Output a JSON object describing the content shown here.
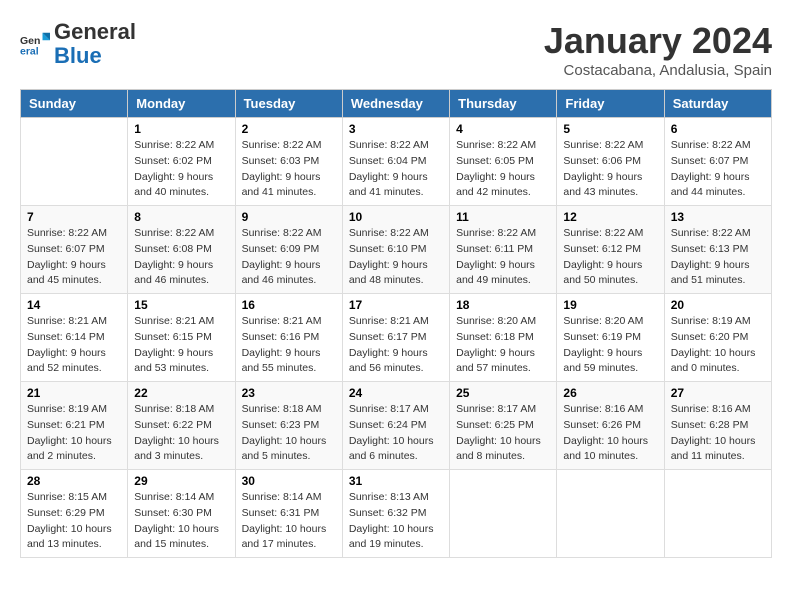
{
  "logo": {
    "general": "General",
    "blue": "Blue"
  },
  "header": {
    "month": "January 2024",
    "location": "Costacabana, Andalusia, Spain"
  },
  "weekdays": [
    "Sunday",
    "Monday",
    "Tuesday",
    "Wednesday",
    "Thursday",
    "Friday",
    "Saturday"
  ],
  "weeks": [
    [
      {
        "num": "",
        "sunrise": "",
        "sunset": "",
        "daylight": ""
      },
      {
        "num": "1",
        "sunrise": "Sunrise: 8:22 AM",
        "sunset": "Sunset: 6:02 PM",
        "daylight": "Daylight: 9 hours and 40 minutes."
      },
      {
        "num": "2",
        "sunrise": "Sunrise: 8:22 AM",
        "sunset": "Sunset: 6:03 PM",
        "daylight": "Daylight: 9 hours and 41 minutes."
      },
      {
        "num": "3",
        "sunrise": "Sunrise: 8:22 AM",
        "sunset": "Sunset: 6:04 PM",
        "daylight": "Daylight: 9 hours and 41 minutes."
      },
      {
        "num": "4",
        "sunrise": "Sunrise: 8:22 AM",
        "sunset": "Sunset: 6:05 PM",
        "daylight": "Daylight: 9 hours and 42 minutes."
      },
      {
        "num": "5",
        "sunrise": "Sunrise: 8:22 AM",
        "sunset": "Sunset: 6:06 PM",
        "daylight": "Daylight: 9 hours and 43 minutes."
      },
      {
        "num": "6",
        "sunrise": "Sunrise: 8:22 AM",
        "sunset": "Sunset: 6:07 PM",
        "daylight": "Daylight: 9 hours and 44 minutes."
      }
    ],
    [
      {
        "num": "7",
        "sunrise": "Sunrise: 8:22 AM",
        "sunset": "Sunset: 6:07 PM",
        "daylight": "Daylight: 9 hours and 45 minutes."
      },
      {
        "num": "8",
        "sunrise": "Sunrise: 8:22 AM",
        "sunset": "Sunset: 6:08 PM",
        "daylight": "Daylight: 9 hours and 46 minutes."
      },
      {
        "num": "9",
        "sunrise": "Sunrise: 8:22 AM",
        "sunset": "Sunset: 6:09 PM",
        "daylight": "Daylight: 9 hours and 46 minutes."
      },
      {
        "num": "10",
        "sunrise": "Sunrise: 8:22 AM",
        "sunset": "Sunset: 6:10 PM",
        "daylight": "Daylight: 9 hours and 48 minutes."
      },
      {
        "num": "11",
        "sunrise": "Sunrise: 8:22 AM",
        "sunset": "Sunset: 6:11 PM",
        "daylight": "Daylight: 9 hours and 49 minutes."
      },
      {
        "num": "12",
        "sunrise": "Sunrise: 8:22 AM",
        "sunset": "Sunset: 6:12 PM",
        "daylight": "Daylight: 9 hours and 50 minutes."
      },
      {
        "num": "13",
        "sunrise": "Sunrise: 8:22 AM",
        "sunset": "Sunset: 6:13 PM",
        "daylight": "Daylight: 9 hours and 51 minutes."
      }
    ],
    [
      {
        "num": "14",
        "sunrise": "Sunrise: 8:21 AM",
        "sunset": "Sunset: 6:14 PM",
        "daylight": "Daylight: 9 hours and 52 minutes."
      },
      {
        "num": "15",
        "sunrise": "Sunrise: 8:21 AM",
        "sunset": "Sunset: 6:15 PM",
        "daylight": "Daylight: 9 hours and 53 minutes."
      },
      {
        "num": "16",
        "sunrise": "Sunrise: 8:21 AM",
        "sunset": "Sunset: 6:16 PM",
        "daylight": "Daylight: 9 hours and 55 minutes."
      },
      {
        "num": "17",
        "sunrise": "Sunrise: 8:21 AM",
        "sunset": "Sunset: 6:17 PM",
        "daylight": "Daylight: 9 hours and 56 minutes."
      },
      {
        "num": "18",
        "sunrise": "Sunrise: 8:20 AM",
        "sunset": "Sunset: 6:18 PM",
        "daylight": "Daylight: 9 hours and 57 minutes."
      },
      {
        "num": "19",
        "sunrise": "Sunrise: 8:20 AM",
        "sunset": "Sunset: 6:19 PM",
        "daylight": "Daylight: 9 hours and 59 minutes."
      },
      {
        "num": "20",
        "sunrise": "Sunrise: 8:19 AM",
        "sunset": "Sunset: 6:20 PM",
        "daylight": "Daylight: 10 hours and 0 minutes."
      }
    ],
    [
      {
        "num": "21",
        "sunrise": "Sunrise: 8:19 AM",
        "sunset": "Sunset: 6:21 PM",
        "daylight": "Daylight: 10 hours and 2 minutes."
      },
      {
        "num": "22",
        "sunrise": "Sunrise: 8:18 AM",
        "sunset": "Sunset: 6:22 PM",
        "daylight": "Daylight: 10 hours and 3 minutes."
      },
      {
        "num": "23",
        "sunrise": "Sunrise: 8:18 AM",
        "sunset": "Sunset: 6:23 PM",
        "daylight": "Daylight: 10 hours and 5 minutes."
      },
      {
        "num": "24",
        "sunrise": "Sunrise: 8:17 AM",
        "sunset": "Sunset: 6:24 PM",
        "daylight": "Daylight: 10 hours and 6 minutes."
      },
      {
        "num": "25",
        "sunrise": "Sunrise: 8:17 AM",
        "sunset": "Sunset: 6:25 PM",
        "daylight": "Daylight: 10 hours and 8 minutes."
      },
      {
        "num": "26",
        "sunrise": "Sunrise: 8:16 AM",
        "sunset": "Sunset: 6:26 PM",
        "daylight": "Daylight: 10 hours and 10 minutes."
      },
      {
        "num": "27",
        "sunrise": "Sunrise: 8:16 AM",
        "sunset": "Sunset: 6:28 PM",
        "daylight": "Daylight: 10 hours and 11 minutes."
      }
    ],
    [
      {
        "num": "28",
        "sunrise": "Sunrise: 8:15 AM",
        "sunset": "Sunset: 6:29 PM",
        "daylight": "Daylight: 10 hours and 13 minutes."
      },
      {
        "num": "29",
        "sunrise": "Sunrise: 8:14 AM",
        "sunset": "Sunset: 6:30 PM",
        "daylight": "Daylight: 10 hours and 15 minutes."
      },
      {
        "num": "30",
        "sunrise": "Sunrise: 8:14 AM",
        "sunset": "Sunset: 6:31 PM",
        "daylight": "Daylight: 10 hours and 17 minutes."
      },
      {
        "num": "31",
        "sunrise": "Sunrise: 8:13 AM",
        "sunset": "Sunset: 6:32 PM",
        "daylight": "Daylight: 10 hours and 19 minutes."
      },
      {
        "num": "",
        "sunrise": "",
        "sunset": "",
        "daylight": ""
      },
      {
        "num": "",
        "sunrise": "",
        "sunset": "",
        "daylight": ""
      },
      {
        "num": "",
        "sunrise": "",
        "sunset": "",
        "daylight": ""
      }
    ]
  ]
}
